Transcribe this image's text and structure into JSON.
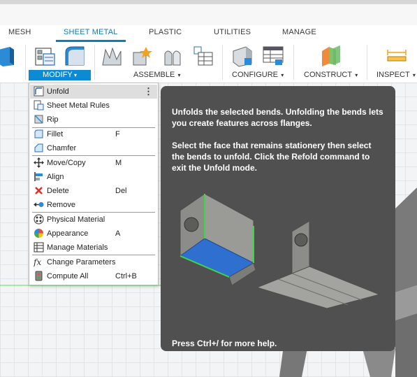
{
  "tabs": [
    "MESH",
    "SHEET METAL",
    "PLASTIC",
    "UTILITIES",
    "MANAGE"
  ],
  "active_tab": "SHEET METAL",
  "toolbar": {
    "groups": {
      "modify": "MODIFY",
      "assemble": "ASSEMBLE",
      "configure": "CONFIGURE",
      "construct": "CONSTRUCT",
      "inspect": "INSPECT"
    },
    "accent_color": "#0a8bd3"
  },
  "menu": {
    "items": [
      {
        "label": "Unfold",
        "shortcut": "",
        "icon": "unfold-icon"
      },
      {
        "label": "Sheet Metal Rules",
        "shortcut": "",
        "icon": "sheet-metal-rules-icon"
      },
      {
        "label": "Rip",
        "shortcut": "",
        "icon": "rip-icon"
      },
      {
        "label": "Fillet",
        "shortcut": "F",
        "icon": "fillet-icon"
      },
      {
        "label": "Chamfer",
        "shortcut": "",
        "icon": "chamfer-icon"
      },
      {
        "label": "Move/Copy",
        "shortcut": "M",
        "icon": "move-copy-icon"
      },
      {
        "label": "Align",
        "shortcut": "",
        "icon": "align-icon"
      },
      {
        "label": "Delete",
        "shortcut": "Del",
        "icon": "delete-icon"
      },
      {
        "label": "Remove",
        "shortcut": "",
        "icon": "remove-icon"
      },
      {
        "label": "Physical Material",
        "shortcut": "",
        "icon": "physical-material-icon"
      },
      {
        "label": "Appearance",
        "shortcut": "A",
        "icon": "appearance-icon"
      },
      {
        "label": "Manage Materials",
        "shortcut": "",
        "icon": "manage-materials-icon"
      },
      {
        "label": "Change Parameters",
        "shortcut": "",
        "icon": "change-parameters-icon"
      },
      {
        "label": "Compute All",
        "shortcut": "Ctrl+B",
        "icon": "compute-all-icon"
      }
    ],
    "more_options": "⋮"
  },
  "tooltip": {
    "para1": "Unfolds the selected bends. Unfolding the bends lets you create features across flanges.",
    "para2": "Select the face that remains stationery then select the bends to unfold. Click the Refold command to exit the Unfold mode.",
    "footer": "Press Ctrl+/ for more help."
  }
}
